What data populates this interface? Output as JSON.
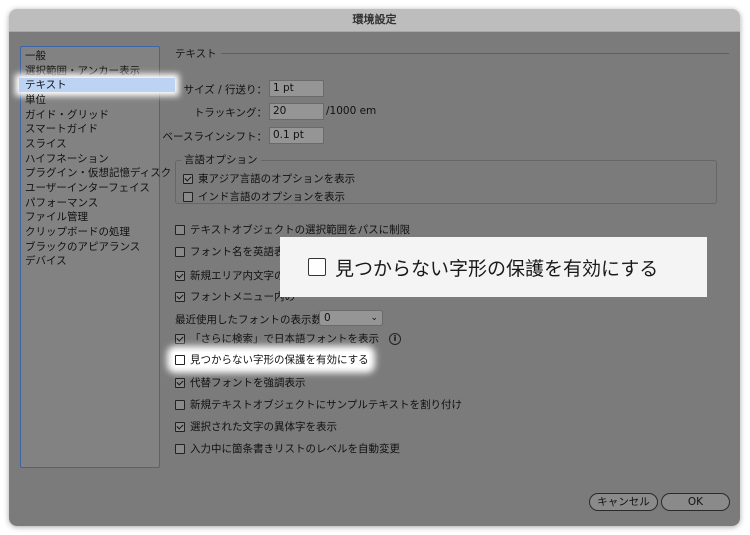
{
  "window": {
    "title": "環境設定"
  },
  "sidebar": {
    "items": [
      {
        "label": "一般",
        "selected": false
      },
      {
        "label": "選択範囲・アンカー表示",
        "selected": false
      },
      {
        "label": "テキスト",
        "selected": true
      },
      {
        "label": "単位",
        "selected": false
      },
      {
        "label": "ガイド・グリッド",
        "selected": false
      },
      {
        "label": "スマートガイド",
        "selected": false
      },
      {
        "label": "スライス",
        "selected": false
      },
      {
        "label": "ハイフネーション",
        "selected": false
      },
      {
        "label": "プラグイン・仮想記憶ディスク",
        "selected": false
      },
      {
        "label": "ユーザーインターフェイス",
        "selected": false
      },
      {
        "label": "パフォーマンス",
        "selected": false
      },
      {
        "label": "ファイル管理",
        "selected": false
      },
      {
        "label": "クリップボードの処理",
        "selected": false
      },
      {
        "label": "ブラックのアピアランス",
        "selected": false
      },
      {
        "label": "デバイス",
        "selected": false
      }
    ]
  },
  "main": {
    "section_title": "テキスト",
    "size_leading": {
      "label": "サイズ / 行送り：",
      "value": "1 pt"
    },
    "tracking": {
      "label": "トラッキング：",
      "value": "20",
      "unit": "/1000 em"
    },
    "baseline_shift": {
      "label": "ベースラインシフト：",
      "value": "0.1 pt"
    },
    "language_options": {
      "title": "言語オプション",
      "east_asian": {
        "label": "東アジア言語のオプションを表示",
        "checked": true
      },
      "indic": {
        "label": "インド言語のオプションを表示",
        "checked": false
      }
    },
    "opt_limit_path": {
      "label": "テキストオブジェクトの選択範囲をパスに制限",
      "checked": false
    },
    "opt_font_names_english": {
      "label": "フォント名を英語表記",
      "checked": false
    },
    "opt_new_area_text": {
      "label": "新規エリア内文字の自",
      "checked": true
    },
    "opt_font_menu": {
      "label": "フォントメニュー内の",
      "checked": true
    },
    "recent_fonts": {
      "label": "最近使用したフォントの表示数：",
      "value": "0",
      "chevron": "⌄"
    },
    "opt_search_japanese": {
      "label": "「さらに検索」で日本語フォントを表示",
      "checked": true,
      "info": "i"
    },
    "opt_missing_glyph": {
      "label": "見つからない字形の保護を有効にする",
      "checked": false
    },
    "opt_highlight_substitute": {
      "label": "代替フォントを強調表示",
      "checked": true
    },
    "opt_fill_placeholder": {
      "label": "新規テキストオブジェクトにサンプルテキストを割り付け",
      "checked": false
    },
    "opt_show_alternates": {
      "label": "選択された文字の異体字を表示",
      "checked": true
    },
    "opt_auto_list_level": {
      "label": "入力中に箇条書きリストのレベルを自動変更",
      "checked": false
    }
  },
  "callout": {
    "label": "見つからない字形の保護を有効にする"
  },
  "buttons": {
    "cancel": "キャンセル",
    "ok": "OK"
  }
}
